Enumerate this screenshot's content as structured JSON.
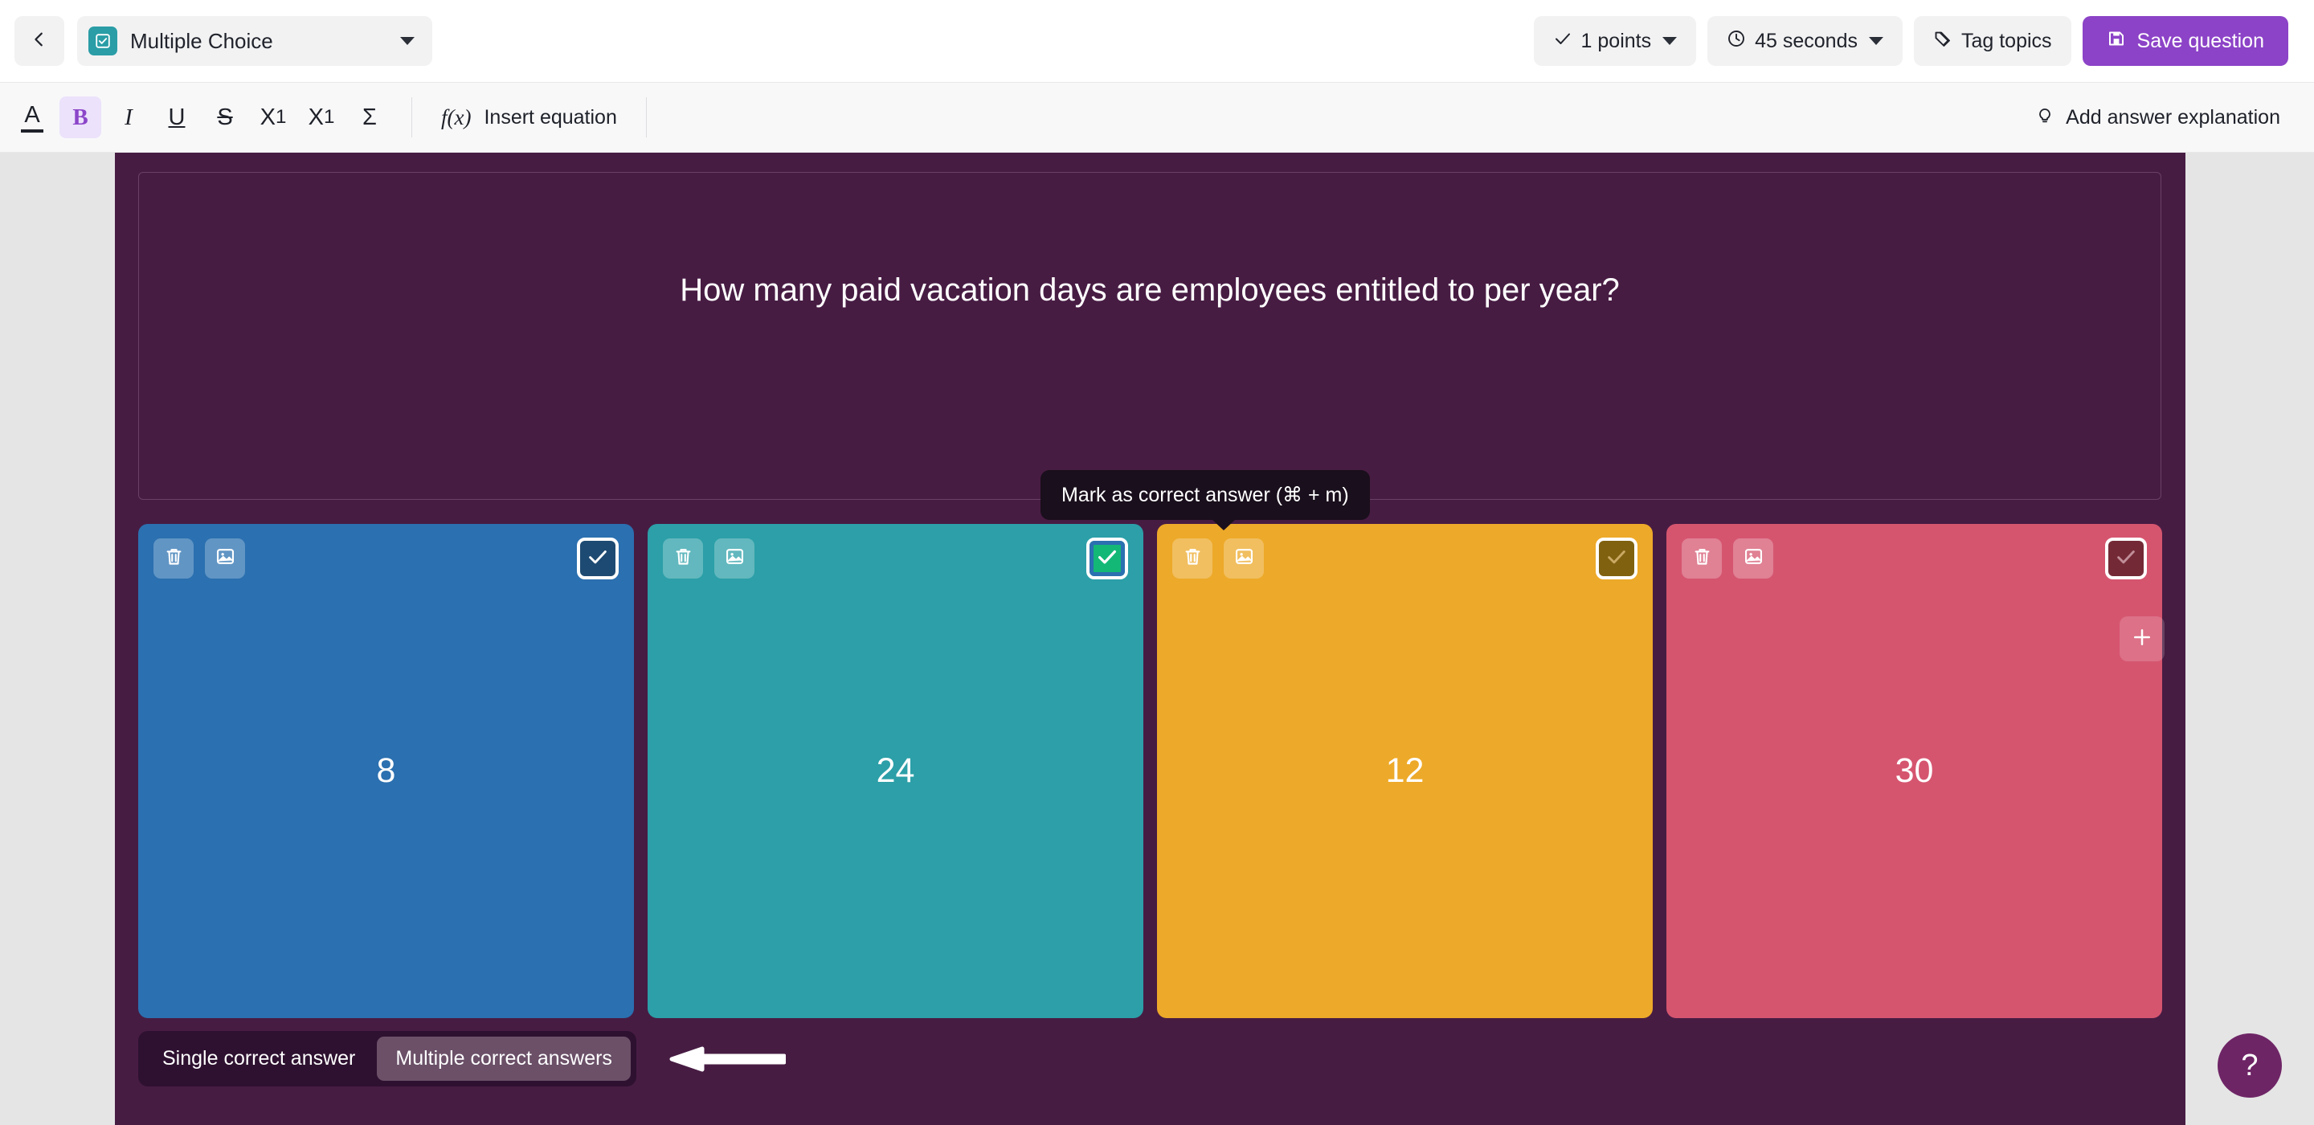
{
  "topbar": {
    "back_icon": "chevron-left-icon",
    "question_type": {
      "icon": "checkbox-icon",
      "label": "Multiple Choice",
      "caret": "chevron-down-icon"
    },
    "points": {
      "icon": "check-icon",
      "label": "1 points",
      "caret": "chevron-down-icon"
    },
    "time": {
      "icon": "clock-icon",
      "label": "45 seconds",
      "caret": "chevron-down-icon"
    },
    "tags": {
      "icon": "tag-icon",
      "label": "Tag topics"
    },
    "save": {
      "icon": "save-disk-icon",
      "label": "Save question"
    }
  },
  "formatbar": {
    "font_color": "A",
    "bold": "B",
    "italic": "I",
    "underline": "U",
    "strikethrough": "S",
    "superscript_base": "X",
    "superscript_exp": "1",
    "subscript_base": "X",
    "subscript_exp": "1",
    "sigma": "Σ",
    "equation": {
      "glyph": "f(x)",
      "label": "Insert equation"
    },
    "explanation": {
      "icon": "lightbulb-icon",
      "label": "Add answer explanation"
    }
  },
  "question": {
    "text": "How many paid vacation days are employees entitled to per year?"
  },
  "tooltip": {
    "text": "Mark as correct answer (⌘ + m)"
  },
  "answers": [
    {
      "text": "8",
      "color": "#2b70b0",
      "selected": false
    },
    {
      "text": "24",
      "color": "#2c9fa8",
      "selected": true
    },
    {
      "text": "12",
      "color": "#eda929",
      "selected": false
    },
    {
      "text": "30",
      "color": "#d5556f",
      "selected": false
    }
  ],
  "card_icons": {
    "delete": "trash-icon",
    "image": "image-icon",
    "check": "check-icon"
  },
  "add_option": {
    "icon": "plus-icon"
  },
  "answer_mode": {
    "options": [
      "Single correct answer",
      "Multiple correct answers"
    ],
    "selected_index": 1
  },
  "annotation": {
    "icon": "arrow-left-icon"
  },
  "help": {
    "label": "?"
  },
  "colors": {
    "canvas_purple": "#471c43",
    "page_gray": "#e5e5e5",
    "accent_purple": "#8c43c7",
    "selected_green": "#13b877",
    "tooltip_bg": "#1a0f1c",
    "segment_bg": "#2e1130",
    "segment_active": "#6b5068",
    "help_bg": "#6e2566"
  }
}
